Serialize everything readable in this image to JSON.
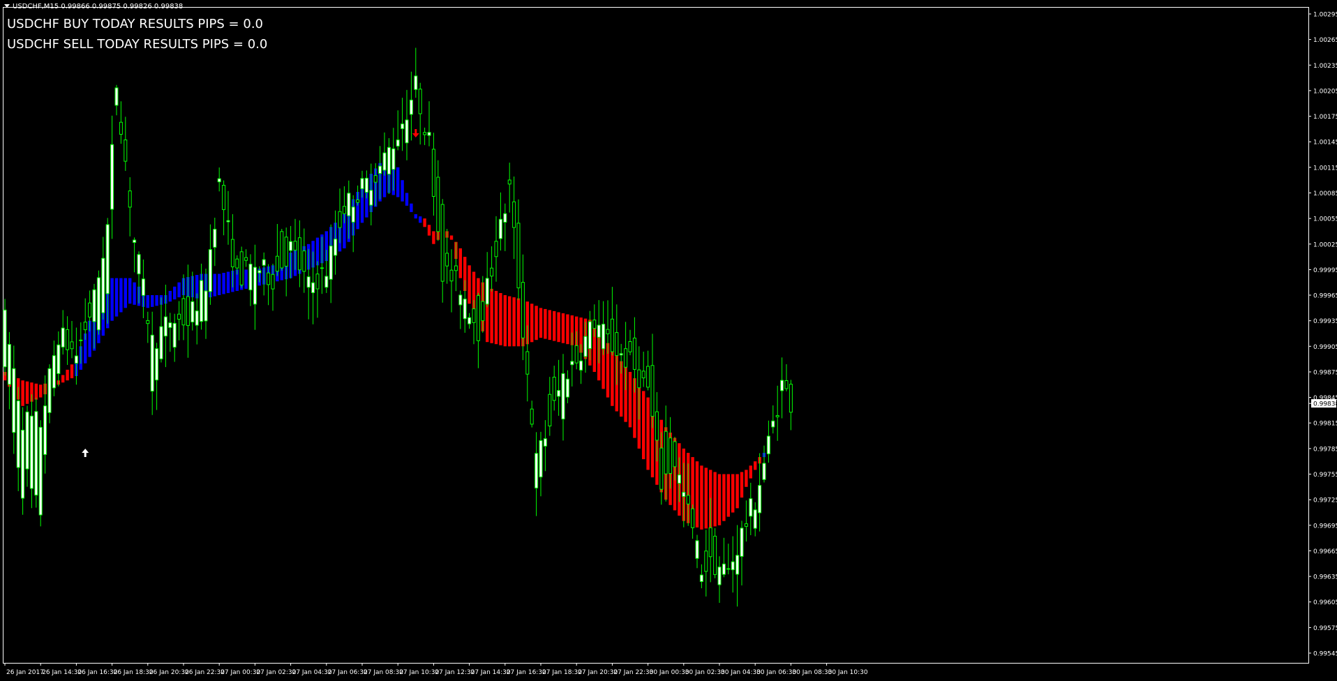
{
  "header": {
    "symbol_line": "USDCHF,M15  0.99866 0.99875 0.99826 0.99838"
  },
  "results": {
    "buy_line": "USDCHF BUY TODAY RESULTS PIPS = 0.0",
    "sell_line": "USDCHF SELL TODAY RESULTS PIPS = 0.0"
  },
  "colors": {
    "background": "#000000",
    "candle_outline": "#00ff00",
    "bull_fill": "#ffffff",
    "bear_fill": "#000000",
    "band_up": "#0000ff",
    "band_down": "#ff0000",
    "buy_arrow": "#ffffff",
    "sell_arrow": "#ff0000"
  },
  "chart_data": {
    "type": "candlestick",
    "symbol": "USDCHF",
    "timeframe": "M15",
    "y_axis_labels": [
      "1.00295",
      "1.00265",
      "1.00235",
      "1.00205",
      "1.00175",
      "1.00145",
      "1.00115",
      "1.00085",
      "1.00055",
      "1.00025",
      "0.99995",
      "0.99965",
      "0.99935",
      "0.99905",
      "0.99875",
      "0.99845",
      "0.99815",
      "0.99785",
      "0.99755",
      "0.99725",
      "0.99695",
      "0.99665",
      "0.99635",
      "0.99605",
      "0.99575",
      "0.99545"
    ],
    "ylim": [
      0.9954,
      1.0031
    ],
    "current_price": "0.99838",
    "x_axis_labels": [
      "26 Jan 2017",
      "26 Jan 14:30",
      "26 Jan 16:30",
      "26 Jan 18:30",
      "26 Jan 20:30",
      "26 Jan 22:30",
      "27 Jan 00:30",
      "27 Jan 02:30",
      "27 Jan 04:30",
      "27 Jan 06:30",
      "27 Jan 08:30",
      "27 Jan 10:30",
      "27 Jan 12:30",
      "27 Jan 14:30",
      "27 Jan 16:30",
      "27 Jan 18:30",
      "27 Jan 20:30",
      "27 Jan 22:30",
      "30 Jan 00:30",
      "30 Jan 02:30",
      "30 Jan 04:30",
      "30 Jan 06:30",
      "30 Jan 08:30",
      "30 Jan 10:30"
    ],
    "bars_between_labels": 8,
    "price_anchors": [
      [
        0,
        0.9987,
        1.0
      ],
      [
        4,
        0.9974,
        0.999
      ],
      [
        8,
        0.9973,
        0.999
      ],
      [
        12,
        0.999,
        0.9994
      ],
      [
        16,
        0.9991,
        0.9988
      ],
      [
        20,
        0.9995,
        0.9997
      ],
      [
        23,
        0.9995,
        1.0014
      ],
      [
        25,
        1.002,
        1.0023
      ],
      [
        29,
        1.0005,
        1.0001
      ],
      [
        33,
        0.9987,
        0.9995
      ],
      [
        37,
        0.9992,
        0.9995
      ],
      [
        41,
        0.9996,
        0.9991
      ],
      [
        45,
        0.9992,
        1.0004
      ],
      [
        48,
        1.0009,
        1.001
      ],
      [
        52,
        1.0002,
        0.9995
      ],
      [
        56,
        0.9998,
        1.0002
      ],
      [
        60,
        1.0,
        0.9997
      ],
      [
        64,
        1.0004,
        1.0
      ],
      [
        68,
        0.9999,
        0.9996
      ],
      [
        72,
        0.9997,
        1.0002
      ],
      [
        76,
        1.0006,
        1.0008
      ],
      [
        80,
        1.0008,
        1.001
      ],
      [
        84,
        1.001,
        1.0013
      ],
      [
        88,
        1.0013,
        1.0018
      ],
      [
        92,
        1.002,
        1.0022
      ],
      [
        95,
        1.0016,
        1.0013
      ],
      [
        98,
        1.0006,
        0.9993
      ],
      [
        102,
        0.9995,
        1.0
      ],
      [
        106,
        0.9994,
        0.9991
      ],
      [
        110,
        1.0,
        1.0004
      ],
      [
        113,
        1.001,
        1.0008
      ],
      [
        116,
        1.0,
        0.9985
      ],
      [
        119,
        0.9972,
        0.9982
      ],
      [
        122,
        0.9985,
        0.9978
      ],
      [
        125,
        0.9984,
        0.999
      ],
      [
        128,
        0.9989,
        0.9989
      ],
      [
        132,
        0.9991,
        0.9996
      ],
      [
        136,
        0.9993,
        0.9988
      ],
      [
        140,
        0.999,
        0.9987
      ],
      [
        144,
        0.9988,
        0.9983
      ],
      [
        147,
        0.9981,
        0.9968
      ],
      [
        150,
        0.9978,
        0.9976
      ],
      [
        153,
        0.9972,
        0.997
      ],
      [
        156,
        0.9965,
        0.9964
      ],
      [
        159,
        0.9967,
        0.9963
      ],
      [
        162,
        0.9962,
        0.9966
      ],
      [
        165,
        0.9967,
        0.997
      ],
      [
        168,
        0.997,
        0.9975
      ],
      [
        171,
        0.9976,
        0.9982
      ],
      [
        174,
        0.9987,
        0.9985
      ],
      [
        176,
        0.9984,
        0.9984
      ]
    ],
    "band_anchors": [
      [
        0,
        0.99875,
        0.99865,
        -1
      ],
      [
        4,
        0.99865,
        0.99835,
        -1
      ],
      [
        8,
        0.9986,
        0.99845,
        -1
      ],
      [
        12,
        0.99865,
        0.9986,
        -1
      ],
      [
        16,
        0.9989,
        0.9987,
        1
      ],
      [
        20,
        0.9995,
        0.999,
        1
      ],
      [
        24,
        0.99985,
        0.99935,
        1
      ],
      [
        28,
        0.99985,
        0.99955,
        1
      ],
      [
        32,
        0.99965,
        0.9995,
        1
      ],
      [
        36,
        0.99965,
        0.99955,
        1
      ],
      [
        40,
        0.99985,
        0.99965,
        1
      ],
      [
        44,
        0.9999,
        0.9996,
        1
      ],
      [
        48,
        0.9999,
        0.99965,
        1
      ],
      [
        52,
        0.99995,
        0.9997,
        1
      ],
      [
        56,
        0.99995,
        0.99975,
        1
      ],
      [
        60,
        1.0,
        0.9998,
        1
      ],
      [
        64,
        1.00015,
        0.99985,
        1
      ],
      [
        68,
        1.00025,
        0.99995,
        1
      ],
      [
        72,
        1.0004,
        1.00005,
        1
      ],
      [
        76,
        1.0006,
        1.0002,
        1
      ],
      [
        80,
        1.00095,
        1.0005,
        1
      ],
      [
        84,
        1.0012,
        1.00075,
        1
      ],
      [
        86,
        1.00125,
        1.00085,
        1
      ],
      [
        88,
        1.00115,
        1.0008,
        1
      ],
      [
        90,
        1.00085,
        1.0007,
        1
      ],
      [
        92,
        1.0006,
        1.00055,
        1
      ],
      [
        94,
        1.00055,
        1.00045,
        -1
      ],
      [
        96,
        1.0004,
        1.00025,
        -1
      ],
      [
        98,
        1.00045,
        1.00035,
        -1
      ],
      [
        100,
        1.00035,
        1.0003,
        -1
      ],
      [
        102,
        1.0002,
        0.99985,
        -1
      ],
      [
        104,
        1.0,
        0.99955,
        -1
      ],
      [
        106,
        0.99985,
        0.99935,
        -1
      ],
      [
        108,
        0.99975,
        0.9991,
        -1
      ],
      [
        112,
        0.99965,
        0.99905,
        -1
      ],
      [
        116,
        0.9996,
        0.99905,
        -1
      ],
      [
        120,
        0.9995,
        0.99915,
        -1
      ],
      [
        124,
        0.99945,
        0.9991,
        -1
      ],
      [
        128,
        0.9994,
        0.99905,
        -1
      ],
      [
        132,
        0.99935,
        0.99875,
        -1
      ],
      [
        136,
        0.999,
        0.99835,
        -1
      ],
      [
        140,
        0.99875,
        0.9981,
        -1
      ],
      [
        144,
        0.99845,
        0.9976,
        -1
      ],
      [
        148,
        0.9981,
        0.99725,
        -1
      ],
      [
        152,
        0.99785,
        0.997,
        -1
      ],
      [
        156,
        0.99765,
        0.9969,
        -1
      ],
      [
        160,
        0.99755,
        0.99695,
        -1
      ],
      [
        164,
        0.99755,
        0.99715,
        -1
      ],
      [
        166,
        0.9976,
        0.9974,
        -1
      ],
      [
        168,
        0.9977,
        0.9976,
        -1
      ],
      [
        170,
        0.9978,
        0.99775,
        1
      ],
      [
        171,
        0.99785,
        0.9978,
        1
      ]
    ],
    "signals": [
      {
        "type": "buy",
        "bar": 18,
        "price": 0.9978
      },
      {
        "type": "sell",
        "bar": 92,
        "price": 1.00155
      }
    ]
  }
}
